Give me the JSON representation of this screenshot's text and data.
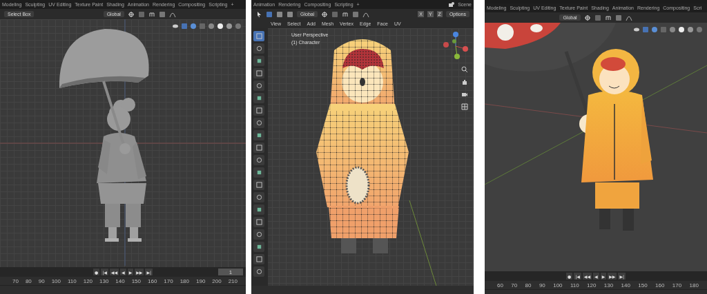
{
  "panels": [
    {
      "kind": "solid",
      "tabs": [
        "Modeling",
        "Sculpting",
        "UV Editing",
        "Texture Paint",
        "Shading",
        "Animation",
        "Rendering",
        "Compositing",
        "Scripting",
        "+"
      ],
      "header": {
        "select_mode": "Select Box",
        "orientation": "Global"
      },
      "playback": [
        "●",
        "|◀",
        "◀◀",
        "◀",
        "▶",
        "▶▶",
        "▶|"
      ],
      "frame": "1",
      "ruler": [
        "70",
        "80",
        "90",
        "100",
        "110",
        "120",
        "130",
        "140",
        "150",
        "160",
        "170",
        "180",
        "190",
        "200",
        "210"
      ]
    },
    {
      "kind": "wireframe",
      "tabs": [
        "Animation",
        "Rendering",
        "Compositing",
        "Scripting",
        "+"
      ],
      "scene": "Scene",
      "header": {
        "orientation": "Global",
        "axes": [
          "X",
          "Y",
          "Z"
        ],
        "options": "Options"
      },
      "menu": [
        "View",
        "Select",
        "Add",
        "Mesh",
        "Vertex",
        "Edge",
        "Face",
        "UV"
      ],
      "overlay": [
        "User Perspective",
        "(1) Character"
      ],
      "tools": [
        {
          "selected": true
        },
        {
          "selected": false
        },
        {
          "selected": false
        },
        {
          "selected": false
        },
        {
          "selected": false
        },
        {
          "selected": false
        },
        {
          "selected": false
        },
        {
          "selected": false
        },
        {
          "selected": false
        },
        {
          "selected": false
        },
        {
          "selected": false
        },
        {
          "selected": false
        },
        {
          "selected": false
        },
        {
          "selected": false
        },
        {
          "selected": false
        },
        {
          "selected": false
        },
        {
          "selected": false
        },
        {
          "selected": false
        },
        {
          "selected": false
        },
        {
          "selected": false
        }
      ]
    },
    {
      "kind": "textured",
      "tabs": [
        "Modeling",
        "Sculpting",
        "UV Editing",
        "Texture Paint",
        "Shading",
        "Animation",
        "Rendering",
        "Compositing",
        "Scri"
      ],
      "header": {
        "orientation": "Global"
      },
      "playback": [
        "●",
        "|◀",
        "◀◀",
        "◀",
        "▶",
        "▶▶",
        "▶|"
      ],
      "ruler": [
        "60",
        "70",
        "80",
        "90",
        "100",
        "110",
        "120",
        "130",
        "140",
        "150",
        "160",
        "170",
        "180"
      ]
    }
  ]
}
